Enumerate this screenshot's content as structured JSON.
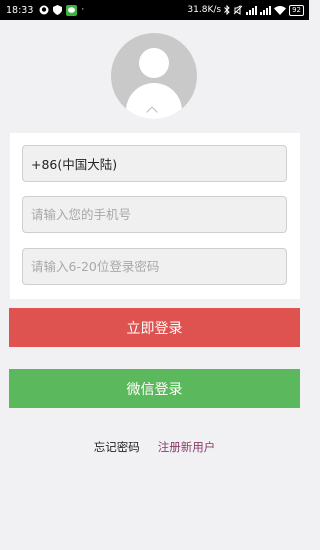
{
  "status_bar": {
    "time": "18:33",
    "dot": "·",
    "network_speed": "31.8K/s",
    "battery": "92",
    "icons": [
      "qq-icon",
      "shield-icon",
      "wechat-icon",
      "bluetooth-icon",
      "mute-icon",
      "signal-icon",
      "signal-icon",
      "wifi-icon",
      "battery-icon"
    ]
  },
  "login_form": {
    "country_code": "+86(中国大陆)",
    "phone_placeholder": "请输入您的手机号",
    "password_placeholder": "请输入6-20位登录密码"
  },
  "buttons": {
    "login_label": "立即登录",
    "wechat_login_label": "微信登录"
  },
  "links": {
    "forgot_password": "忘记密码",
    "register": "注册新用户"
  },
  "colors": {
    "login_button": "#de5350",
    "wechat_button": "#5cb85c",
    "register_link": "#8b3a6b",
    "background": "#f1f1f3"
  }
}
